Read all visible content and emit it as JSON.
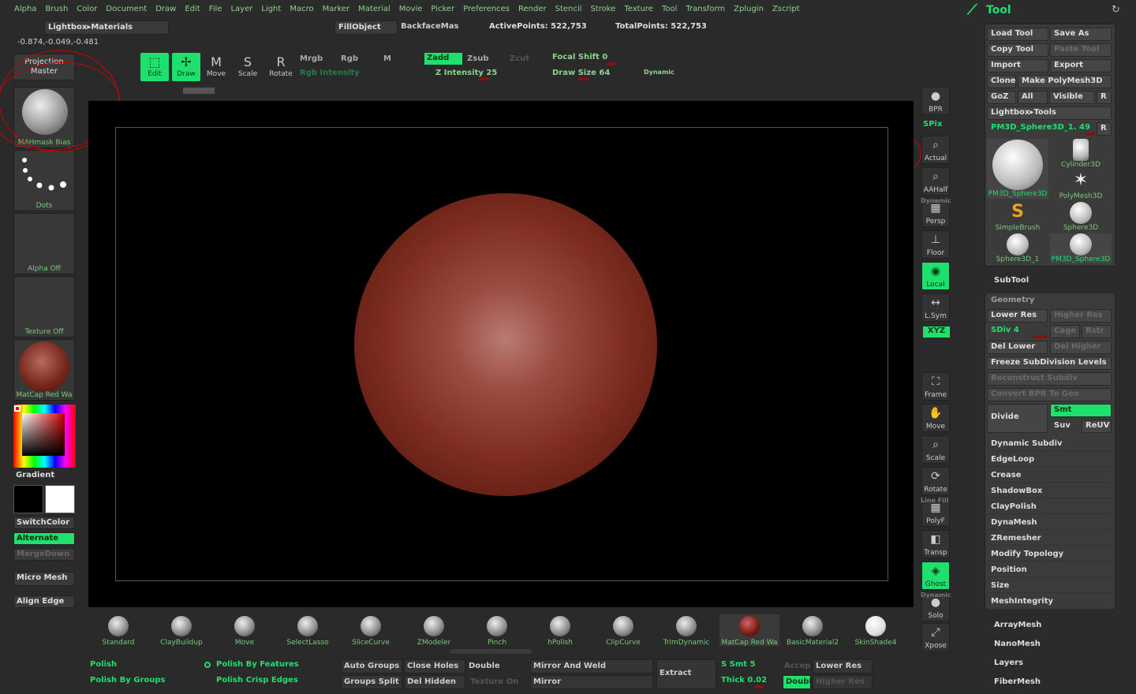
{
  "menu": [
    "Alpha",
    "Brush",
    "Color",
    "Document",
    "Draw",
    "Edit",
    "File",
    "Layer",
    "Light",
    "Macro",
    "Marker",
    "Material",
    "Movie",
    "Picker",
    "Preferences",
    "Render",
    "Stencil",
    "Stroke",
    "Texture",
    "Tool",
    "Transform",
    "Zplugin",
    "Zscript"
  ],
  "topbar": {
    "lightbox_materials": "Lightbox▸Materials",
    "fill_object": "FillObject",
    "backface": "BackfaceMas",
    "active_points": "ActivePoints: 522,753",
    "total_points": "TotalPoints: 522,753"
  },
  "coords": "-0.874,-0.049,-0.481",
  "left": {
    "projection_master": "Projection Master",
    "brush_label": "MAHmask Bias",
    "stroke_label": "Dots",
    "alpha_label": "Alpha Off",
    "texture_label": "Texture Off",
    "material_label": "MatCap Red Wa",
    "gradient": "Gradient",
    "switch_color": "SwitchColor",
    "alternate": "Alternate",
    "merge_down": "MergeDown",
    "micro_mesh": "Micro Mesh",
    "align_edge": "Align Edge"
  },
  "toolbar": {
    "edit": "Edit",
    "draw": "Draw",
    "move": "Move",
    "scale": "Scale",
    "rotate": "Rotate",
    "mrgb": "Mrgb",
    "rgb": "Rgb",
    "m": "M",
    "zadd": "Zadd",
    "zsub": "Zsub",
    "zcut": "Zcut",
    "rgb_intensity": "Rgb Intensity",
    "z_intensity": "Z Intensity 25",
    "focal_shift": "Focal Shift 0",
    "draw_size": "Draw Size 64",
    "dynamic": "Dynamic"
  },
  "right_tools": [
    "BPR",
    "SPix",
    "Actual",
    "AAHalf",
    "Persp",
    "Floor",
    "Local",
    "L.Sym",
    "XYZ",
    "Frame",
    "Move",
    "Scale",
    "Rotate",
    "PolyF",
    "Transp",
    "Ghost",
    "Solo",
    "Xpose"
  ],
  "right_tool_extras": [
    "Dynamic",
    "Line Fill",
    "Dynamic"
  ],
  "brushes": [
    "Standard",
    "ClayBuildup",
    "Move",
    "SelectLasso",
    "SliceCurve",
    "ZModeler",
    "Pinch",
    "hPolish",
    "ClipCurve",
    "TrimDynamic",
    "MatCap Red Wa",
    "BasicMaterial2",
    "SkinShade4"
  ],
  "bottom": {
    "polish": "Polish",
    "polish_by_groups": "Polish By Groups",
    "polish_by_features": "Polish By Features",
    "polish_crisp_edges": "Polish Crisp Edges",
    "auto_groups": "Auto Groups",
    "groups_split": "Groups Split",
    "close_holes": "Close Holes",
    "del_hidden": "Del Hidden",
    "double": "Double",
    "texture_on": "Texture On",
    "mirror_and_weld": "Mirror And Weld",
    "mirror": "Mirror",
    "extract": "Extract",
    "s_smt": "S Smt 5",
    "thick": "Thick 0.02",
    "accep": "Accep",
    "double2": "Doubl",
    "lower_res": "Lower Res",
    "higher_res": "Higher Res"
  },
  "panel": {
    "title": "Tool",
    "load_tool": "Load Tool",
    "save_as": "Save As",
    "copy_tool": "Copy Tool",
    "paste_tool": "Paste Tool",
    "import": "Import",
    "export": "Export",
    "clone": "Clone",
    "make_polymesh": "Make PolyMesh3D",
    "goz": "GoZ",
    "all": "All",
    "visible": "Visible",
    "r": "R",
    "lightbox_tools": "Lightbox▸Tools",
    "current_tool": "PM3D_Sphere3D_1. 49",
    "thumbs": [
      "PM3D_Sphere3D",
      "Cylinder3D",
      "PolyMesh3D",
      "SimpleBrush",
      "Sphere3D",
      "Sphere3D_1",
      "PM3D_Sphere3D"
    ],
    "subtool": "SubTool",
    "geometry": "Geometry",
    "lower_res": "Lower Res",
    "higher_res": "Higher Res",
    "sdiv": "SDiv 4",
    "cage": "Cage",
    "rstr": "Rstr",
    "del_lower": "Del Lower",
    "del_higher": "Del Higher",
    "freeze": "Freeze SubDivision Levels",
    "reconstruct": "Reconstruct Subdiv",
    "convert_bpr": "Convert BPR To Geo",
    "divide": "Divide",
    "smt": "Smt",
    "suv": "Suv",
    "reuv": "ReUV",
    "sections": [
      "Dynamic Subdiv",
      "EdgeLoop",
      "Crease",
      "ShadowBox",
      "ClayPolish",
      "DynaMesh",
      "ZRemesher",
      "Modify Topology",
      "Position",
      "Size",
      "MeshIntegrity"
    ],
    "extra": [
      "ArrayMesh",
      "NanoMesh",
      "Layers",
      "FiberMesh"
    ]
  }
}
